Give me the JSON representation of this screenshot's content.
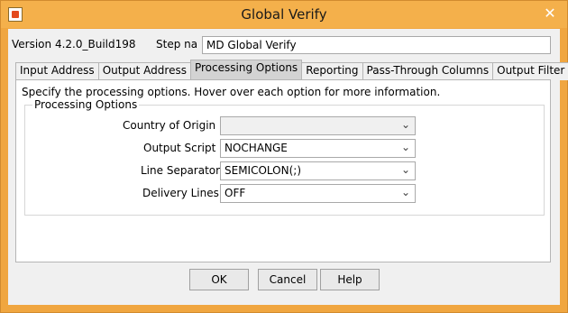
{
  "window": {
    "title": "Global Verify",
    "app_icon": "app-icon",
    "close_icon": "close-icon",
    "close_glyph": "✕"
  },
  "header": {
    "version": "Version 4.2.0_Build198",
    "step_name_label": "Step nam",
    "step_name_value": "MD Global Verify"
  },
  "tabs": [
    {
      "label": "Input Address",
      "active": false
    },
    {
      "label": "Output Address",
      "active": false
    },
    {
      "label": "Processing Options",
      "active": true
    },
    {
      "label": "Reporting",
      "active": false
    },
    {
      "label": "Pass-Through Columns",
      "active": false
    },
    {
      "label": "Output Filter",
      "active": false
    }
  ],
  "panel": {
    "instructions": "Specify the processing options. Hover over each option for more information.",
    "group_title": "Processing Options",
    "options": [
      {
        "label": "Country of Origin",
        "value": "",
        "disabled": true
      },
      {
        "label": "Output Script",
        "value": "NOCHANGE",
        "disabled": false
      },
      {
        "label": "Line Separator",
        "value": "SEMICOLON(;)",
        "disabled": false
      },
      {
        "label": "Delivery Lines",
        "value": "OFF",
        "disabled": false
      }
    ],
    "dropdown_glyph": "⌄"
  },
  "buttons": {
    "ok": "OK",
    "cancel": "Cancel",
    "help": "Help"
  }
}
